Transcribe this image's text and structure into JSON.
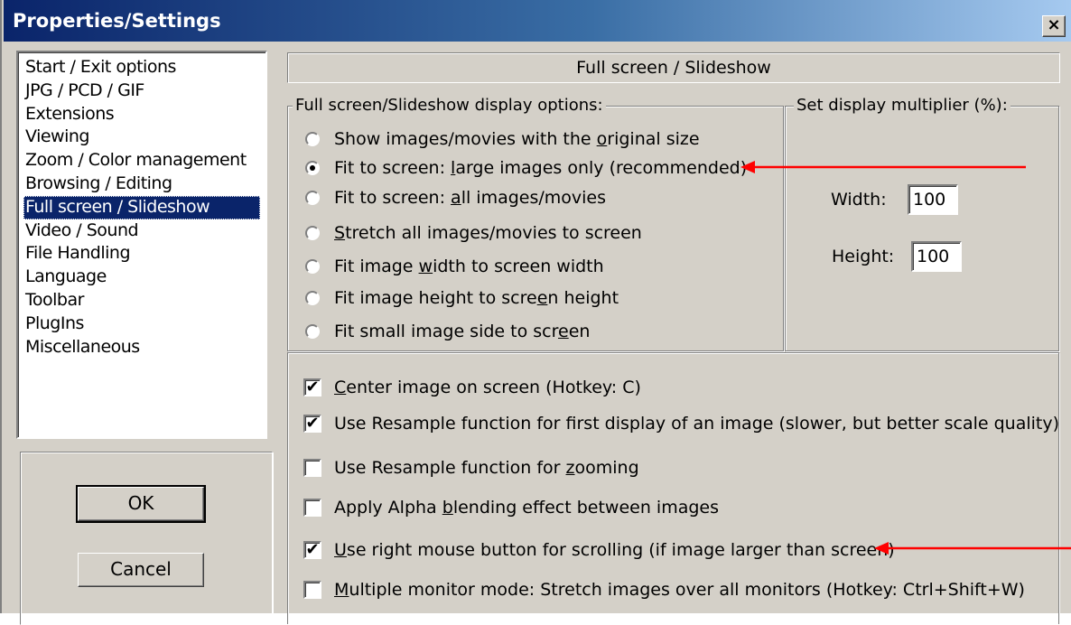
{
  "window": {
    "title": "Properties/Settings",
    "close_label": "×"
  },
  "categories": [
    "Start / Exit options",
    "JPG / PCD / GIF",
    "Extensions",
    "Viewing",
    "Zoom / Color management",
    "Browsing / Editing",
    "Full screen / Slideshow",
    "Video / Sound",
    "File Handling",
    "Language",
    "Toolbar",
    "PlugIns",
    "Miscellaneous"
  ],
  "selected_category": "Full screen / Slideshow",
  "buttons": {
    "ok": "OK",
    "cancel": "Cancel"
  },
  "panel": {
    "heading": "Full screen / Slideshow",
    "display_options": {
      "title": "Full screen/Slideshow display options:",
      "selected": "Fit to screen: large images only (recommended)",
      "options": [
        {
          "pre": "Show images/movies with the ",
          "u": "o",
          "post": "riginal size"
        },
        {
          "pre": "Fit to screen: ",
          "u": "l",
          "post": "arge images only (recommended)"
        },
        {
          "pre": "Fit to screen: ",
          "u": "a",
          "post": "ll images/movies"
        },
        {
          "pre": "",
          "u": "S",
          "post": "tretch all images/movies to screen"
        },
        {
          "pre": "Fit image ",
          "u": "w",
          "post": "idth to screen width"
        },
        {
          "pre": "Fit image height to scre",
          "u": "e",
          "post": "n height"
        },
        {
          "pre": "Fit small image side to scr",
          "u": "e",
          "post": "en"
        }
      ]
    },
    "multiplier": {
      "title": "Set display multiplier (%):",
      "width_label": "Width:",
      "width_value": "100",
      "height_label": "Height:",
      "height_value": "100"
    },
    "checkboxes": [
      {
        "pre": "",
        "u": "C",
        "post": "enter image on screen (Hotkey: C)",
        "checked": true
      },
      {
        "pre": "Use Resample function for first display of an image (slower, but better scale quality)",
        "u": "",
        "post": "",
        "checked": true
      },
      {
        "pre": "Use Resample function for ",
        "u": "z",
        "post": "ooming",
        "checked": false
      },
      {
        "pre": "Apply Alpha ",
        "u": "b",
        "post": "lending effect between images",
        "checked": false
      },
      {
        "pre": "",
        "u": "U",
        "post": "se right mouse button for scrolling (if image larger than screen)",
        "checked": true
      },
      {
        "pre": "",
        "u": "M",
        "post": "ultiple monitor mode: Stretch images over all monitors (Hotkey: Ctrl+Shift+W)",
        "checked": false
      }
    ],
    "check_mark": "✔"
  },
  "colors": {
    "annotation_arrow": "#ff0000",
    "selection": "#0a246a",
    "dialog_bg": "#d4d0c8"
  }
}
